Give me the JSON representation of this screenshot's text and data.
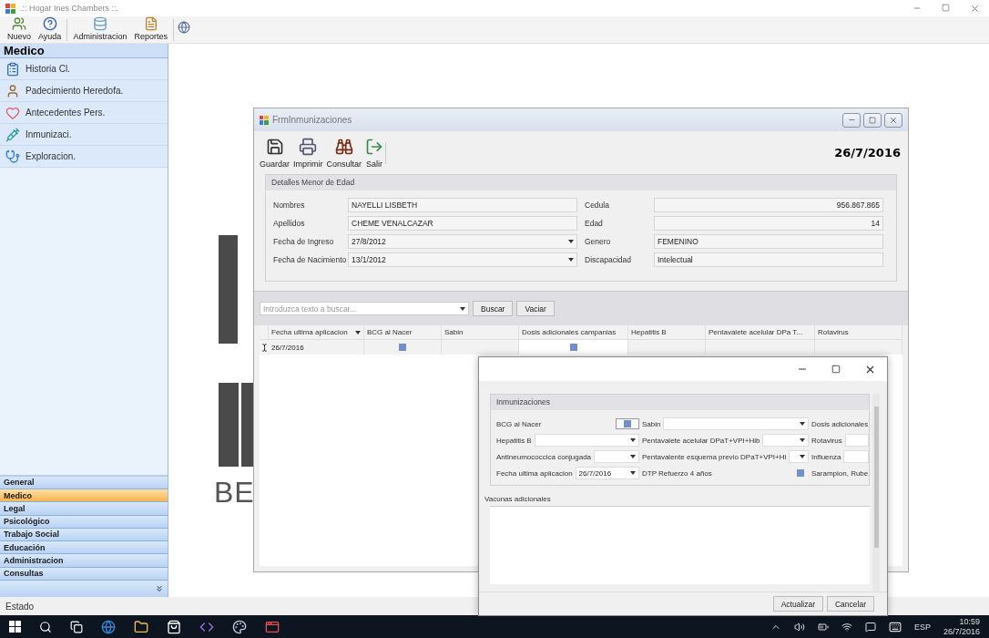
{
  "window": {
    "title": ".:: Hogar Ines Chambers ::."
  },
  "toolbar": [
    "Nuevo",
    "Ayuda",
    "Administracion",
    "Reportes"
  ],
  "sidebar": {
    "header": "Medico",
    "items": [
      "Historia Cl.",
      "Padecimiento Heredofa.",
      "Antecedentes Pers.",
      "Inmunizaci.",
      "Exploracion."
    ],
    "sections": [
      {
        "label": "General",
        "selected": false
      },
      {
        "label": "Medico",
        "selected": true
      },
      {
        "label": "Legal",
        "selected": false
      },
      {
        "label": "Psicológico",
        "selected": false
      },
      {
        "label": "Trabajo Social",
        "selected": false
      },
      {
        "label": "Educación",
        "selected": false
      },
      {
        "label": "Administracion",
        "selected": false
      },
      {
        "label": "Consultas",
        "selected": false
      }
    ]
  },
  "background_logo": {
    "text": "BE"
  },
  "form": {
    "title": "FrmInmunizaciones",
    "toolbar": [
      "Guardar",
      "Imprimir",
      "Consultar",
      "Salir"
    ],
    "date": "26/7/2016",
    "group": {
      "title": "Detalles Menor de Edad",
      "fields": [
        {
          "label": "Nombres",
          "value": "NAYELLI LISBETH",
          "kind": "text"
        },
        {
          "label": "Cedula",
          "value": "956.867.865",
          "kind": "number"
        },
        {
          "label": "Apellidos",
          "value": "CHEME VENALCAZAR",
          "kind": "text"
        },
        {
          "label": "Edad",
          "value": "14",
          "kind": "number"
        },
        {
          "label": "Fecha de Ingreso",
          "value": "27/8/2012",
          "kind": "date"
        },
        {
          "label": "Genero",
          "value": "FEMENINO",
          "kind": "text"
        },
        {
          "label": "Fecha de Nacimiento",
          "value": "13/1/2012",
          "kind": "date"
        },
        {
          "label": "Discapacidad",
          "value": "Intelectual",
          "kind": "text"
        }
      ]
    },
    "search": {
      "placeholder": "Introduzca texto a buscar...",
      "buttons": [
        "Buscar",
        "Vaciar"
      ]
    },
    "grid": {
      "columns": [
        "Fecha ultima aplicacion",
        "BCG al Nacer",
        "Sabin",
        "Dosis adicionales campanias",
        "Hepatitis B",
        "Pentavalete acelular DPa T...",
        "Rotavirus"
      ],
      "rows": [
        {
          "cells": [
            {
              "kind": "text",
              "value": "26/7/2016"
            },
            {
              "kind": "check",
              "checked": true
            },
            {
              "kind": "text"
            },
            {
              "kind": "check",
              "checked": true
            },
            {
              "kind": "text"
            },
            {
              "kind": "text"
            },
            {
              "kind": "text"
            }
          ]
        }
      ]
    }
  },
  "dialog": {
    "group_title": "Inmunizaciones",
    "fields": [
      {
        "label": "BCG al Nacer",
        "kind": "check",
        "checked": true
      },
      {
        "label": "Sabin",
        "kind": "combo"
      },
      {
        "label": "Dosis adicionales",
        "kind": "none"
      },
      {
        "label": "Hepatitis B",
        "kind": "combo"
      },
      {
        "label": "Pentavalete acelular DPaT+VPI+Hib",
        "kind": "combo"
      },
      {
        "label": "Rotavirus",
        "kind": "text"
      },
      {
        "label": "Antineumococcica conjugada",
        "kind": "combo"
      },
      {
        "label": "Pentavalente esquema previo DPaT+VPI+Hi",
        "kind": "combo"
      },
      {
        "label": "Influenza",
        "kind": "text"
      },
      {
        "label": "Fecha ultima aplicacion",
        "kind": "date",
        "value": "26/7/2016"
      },
      {
        "label": "DTP Refuerzo 4 años",
        "kind": "check",
        "checked": true
      },
      {
        "label": "Sarampion, Rube",
        "kind": "none"
      }
    ],
    "notes_label": "Vacunas adicionales",
    "buttons": [
      "Actualizar",
      "Cancelar"
    ]
  },
  "status_bar": "Estado",
  "taskbar": {
    "language": "ESP",
    "time": "10:59",
    "date": "26/7/2016"
  }
}
